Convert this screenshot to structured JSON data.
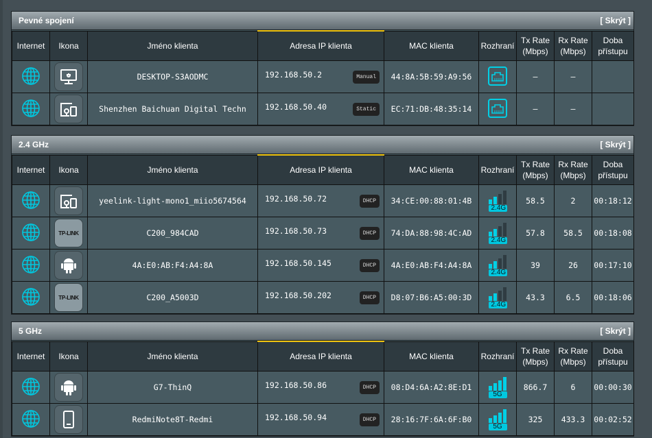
{
  "columns": {
    "internet": "Internet",
    "icon": "Ikona",
    "name": "Jméno klienta",
    "ip": "Adresa IP klienta",
    "mac": "MAC klienta",
    "iface": "Rozhraní",
    "tx": "Tx Rate (Mbps)",
    "rx": "Rx Rate (Mbps)",
    "time": "Doba přístupu"
  },
  "hide_label": "[ Skrýt ]",
  "accent": "#00c8e0",
  "sections": [
    {
      "title": "Pevné spojení",
      "kind": "wired",
      "clients": [
        {
          "icon": "monitor-icon",
          "name": "DESKTOP-S3AODMC",
          "ip": "192.168.50.2",
          "ip_type": "Manual",
          "mac": "44:8A:5B:59:A9:56",
          "tx": "–",
          "rx": "–",
          "time": ""
        },
        {
          "icon": "device-icon",
          "name": "Shenzhen Baichuan Digital Techn",
          "ip": "192.168.50.40",
          "ip_type": "Static",
          "mac": "EC:71:DB:48:35:14",
          "tx": "–",
          "rx": "–",
          "time": ""
        }
      ]
    },
    {
      "title": "2.4 GHz",
      "kind": "wifi",
      "band": "2.4G",
      "clients": [
        {
          "icon": "device-icon",
          "name": "yeelink-light-mono1_miio5674564",
          "ip": "192.168.50.72",
          "ip_type": "DHCP",
          "mac": "34:CE:00:88:01:4B",
          "signal": 2,
          "tx": "58.5",
          "rx": "2",
          "time": "00:18:12"
        },
        {
          "icon": "tplink-icon",
          "icon_text": "TP-LINK",
          "name": "C200_984CAD",
          "ip": "192.168.50.73",
          "ip_type": "DHCP",
          "mac": "74:DA:88:98:4C:AD",
          "signal": 2,
          "tx": "57.8",
          "rx": "58.5",
          "time": "00:18:08"
        },
        {
          "icon": "android-icon",
          "name": "4A:E0:AB:F4:A4:8A",
          "ip": "192.168.50.145",
          "ip_type": "DHCP",
          "mac": "4A:E0:AB:F4:A4:8A",
          "signal": 2,
          "tx": "39",
          "rx": "26",
          "time": "00:17:10"
        },
        {
          "icon": "tplink-icon",
          "icon_text": "TP-LINK",
          "name": "C200_A5003D",
          "ip": "192.168.50.202",
          "ip_type": "DHCP",
          "mac": "D8:07:B6:A5:00:3D",
          "signal": 2,
          "tx": "43.3",
          "rx": "6.5",
          "time": "00:18:06"
        }
      ]
    },
    {
      "title": "5 GHz",
      "kind": "wifi",
      "band": "5G",
      "clients": [
        {
          "icon": "android-icon",
          "name": "G7-ThinQ",
          "ip": "192.168.50.86",
          "ip_type": "DHCP",
          "mac": "08:D4:6A:A2:8E:D1",
          "signal": 4,
          "tx": "866.7",
          "rx": "6",
          "time": "00:00:30"
        },
        {
          "icon": "phone-icon",
          "name": "RedmiNote8T-Redmi",
          "ip": "192.168.50.94",
          "ip_type": "DHCP",
          "mac": "28:16:7F:6A:6F:B0",
          "signal": 4,
          "tx": "325",
          "rx": "433.3",
          "time": "00:02:52"
        }
      ]
    }
  ]
}
